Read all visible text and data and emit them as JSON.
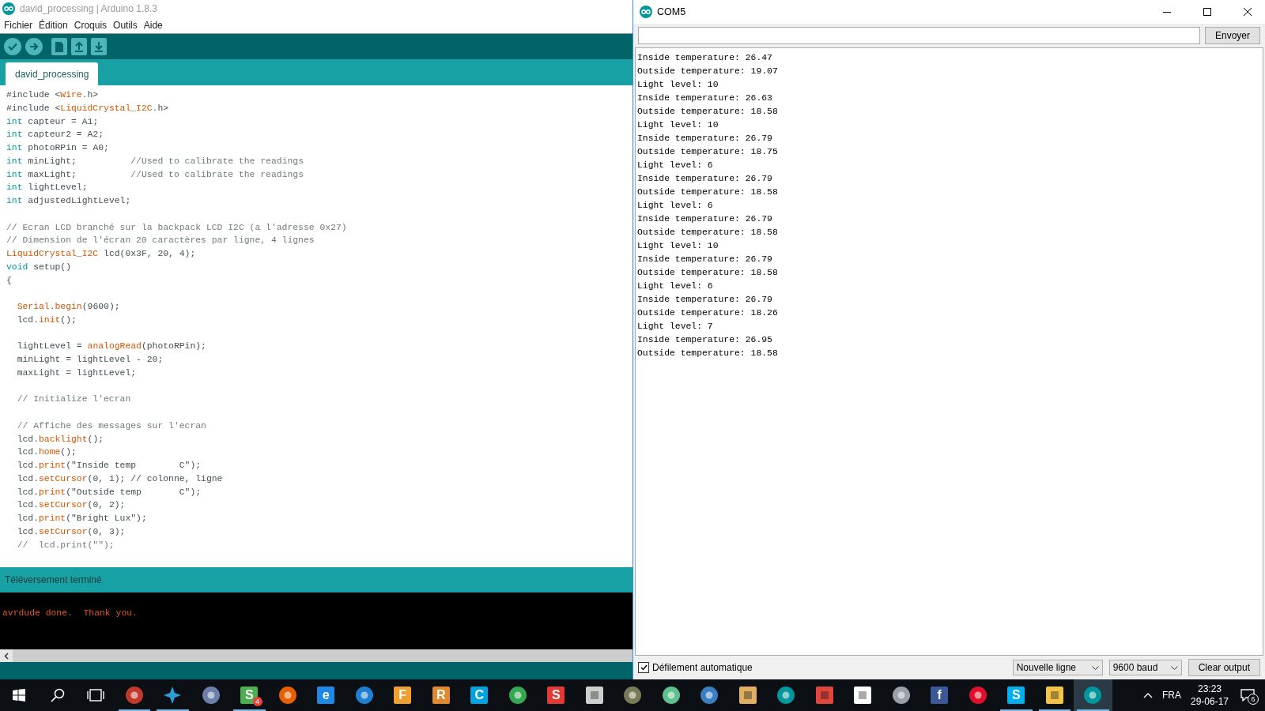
{
  "ide_window": {
    "title": "david_processing | Arduino 1.8.3",
    "menu": [
      "Fichier",
      "Édition",
      "Croquis",
      "Outils",
      "Aide"
    ],
    "toolbar": [
      {
        "kind": "verify"
      },
      {
        "kind": "upload"
      },
      {
        "kind": "new"
      },
      {
        "kind": "open"
      },
      {
        "kind": "save"
      }
    ],
    "tabs": [
      {
        "label": "david_processing",
        "selected": true
      }
    ],
    "code_lines": [
      [
        {
          "text": "#include <",
          "kind": "plain"
        },
        {
          "text": "Wire",
          "kind": "fn"
        },
        {
          "text": ".h>",
          "kind": "plain"
        }
      ],
      [
        {
          "text": "#include <",
          "kind": "plain"
        },
        {
          "text": "LiquidCrystal_I2C",
          "kind": "fn"
        },
        {
          "text": ".h>",
          "kind": "plain"
        }
      ],
      [
        {
          "text": "int",
          "kind": "kw"
        },
        {
          "text": " capteur = A1;",
          "kind": "plain"
        }
      ],
      [
        {
          "text": "int",
          "kind": "kw"
        },
        {
          "text": " capteur2 = A2;",
          "kind": "plain"
        }
      ],
      [
        {
          "text": "int",
          "kind": "kw"
        },
        {
          "text": " photoRPin = A0;",
          "kind": "plain"
        }
      ],
      [
        {
          "text": "int",
          "kind": "kw"
        },
        {
          "text": " minLight;          ",
          "kind": "plain"
        },
        {
          "text": "//Used to calibrate the readings",
          "kind": "comment"
        }
      ],
      [
        {
          "text": "int",
          "kind": "kw"
        },
        {
          "text": " maxLight;          ",
          "kind": "plain"
        },
        {
          "text": "//Used to calibrate the readings",
          "kind": "comment"
        }
      ],
      [
        {
          "text": "int",
          "kind": "kw"
        },
        {
          "text": " lightLevel;",
          "kind": "plain"
        }
      ],
      [
        {
          "text": "int",
          "kind": "kw"
        },
        {
          "text": " adjustedLightLevel;",
          "kind": "plain"
        }
      ],
      {
        "kind": "blank"
      },
      [
        {
          "text": "// Ecran LCD branché sur la backpack LCD I2C (a l'adresse 0x27)",
          "kind": "comment"
        }
      ],
      [
        {
          "text": "// Dimension de l'écran 20 caractères par ligne, 4 lignes",
          "kind": "comment"
        }
      ],
      [
        {
          "text": "LiquidCrystal_I2C",
          "kind": "fn"
        },
        {
          "text": " lcd(0x3F, 20, 4);",
          "kind": "plain"
        }
      ],
      [
        {
          "text": "void",
          "kind": "kw"
        },
        {
          "text": " setup()",
          "kind": "plain"
        }
      ],
      [
        {
          "text": "{",
          "kind": "plain"
        }
      ],
      {
        "kind": "blank"
      },
      [
        {
          "text": "  Serial",
          "kind": "fn"
        },
        {
          "text": ".",
          "kind": "plain"
        },
        {
          "text": "begin",
          "kind": "fn"
        },
        {
          "text": "(9600);",
          "kind": "plain"
        }
      ],
      [
        {
          "text": "  lcd.",
          "kind": "plain"
        },
        {
          "text": "init",
          "kind": "fn"
        },
        {
          "text": "();",
          "kind": "plain"
        }
      ],
      {
        "kind": "blank"
      },
      [
        {
          "text": "  lightLevel = ",
          "kind": "plain"
        },
        {
          "text": "analogRead",
          "kind": "fn"
        },
        {
          "text": "(photoRPin);",
          "kind": "plain"
        }
      ],
      [
        {
          "text": "  minLight = lightLevel - 20;",
          "kind": "plain"
        }
      ],
      [
        {
          "text": "  maxLight = lightLevel;",
          "kind": "plain"
        }
      ],
      {
        "kind": "blank"
      },
      [
        {
          "text": "  // Initialize l'ecran",
          "kind": "comment"
        }
      ],
      {
        "kind": "blank"
      },
      [
        {
          "text": "  // Affiche des messages sur l'ecran",
          "kind": "comment"
        }
      ],
      [
        {
          "text": "  lcd.",
          "kind": "plain"
        },
        {
          "text": "backlight",
          "kind": "fn"
        },
        {
          "text": "();",
          "kind": "plain"
        }
      ],
      [
        {
          "text": "  lcd.",
          "kind": "plain"
        },
        {
          "text": "home",
          "kind": "fn"
        },
        {
          "text": "();",
          "kind": "plain"
        }
      ],
      [
        {
          "text": "  lcd.",
          "kind": "plain"
        },
        {
          "text": "print",
          "kind": "fn"
        },
        {
          "text": "(\"Inside temp        C\");",
          "kind": "plain"
        }
      ],
      [
        {
          "text": "  lcd.",
          "kind": "plain"
        },
        {
          "text": "setCursor",
          "kind": "fn"
        },
        {
          "text": "(0, 1); // colonne, ligne",
          "kind": "plain"
        }
      ],
      [
        {
          "text": "  lcd.",
          "kind": "plain"
        },
        {
          "text": "print",
          "kind": "fn"
        },
        {
          "text": "(\"Outside temp       C\");",
          "kind": "plain"
        }
      ],
      [
        {
          "text": "  lcd.",
          "kind": "plain"
        },
        {
          "text": "setCursor",
          "kind": "fn"
        },
        {
          "text": "(0, 2);",
          "kind": "plain"
        }
      ],
      [
        {
          "text": "  lcd.",
          "kind": "plain"
        },
        {
          "text": "print",
          "kind": "fn"
        },
        {
          "text": "(\"Bright Lux\");",
          "kind": "plain"
        }
      ],
      [
        {
          "text": "  lcd.",
          "kind": "plain"
        },
        {
          "text": "setCursor",
          "kind": "fn"
        },
        {
          "text": "(0, 3);",
          "kind": "plain"
        }
      ],
      [
        {
          "text": "  //  lcd.print(\"\");",
          "kind": "comment"
        }
      ]
    ],
    "status": "Téléversement terminé",
    "console_lines": [
      "avrdude done.  Thank you."
    ]
  },
  "serial_monitor": {
    "title": "COM5",
    "send_button": "Envoyer",
    "output": [
      "Inside temperature: 26.47",
      "Outside temperature: 19.07",
      "Light level: 10",
      "Inside temperature: 26.63",
      "Outside temperature: 18.58",
      "Light level: 10",
      "Inside temperature: 26.79",
      "Outside temperature: 18.75",
      "Light level: 6",
      "Inside temperature: 26.79",
      "Outside temperature: 18.58",
      "Light level: 6",
      "Inside temperature: 26.79",
      "Outside temperature: 18.58",
      "Light level: 10",
      "Inside temperature: 26.79",
      "Outside temperature: 18.58",
      "Light level: 6",
      "Inside temperature: 26.79",
      "Outside temperature: 18.26",
      "Light level: 7",
      "Inside temperature: 26.95",
      "Outside temperature: 18.58"
    ],
    "autoscroll": {
      "label": "Défilement automatique",
      "checked": true
    },
    "line_ending": "Nouvelle ligne",
    "baud": "9600 baud",
    "clear_button": "Clear output"
  },
  "taskbar": {
    "apps": [
      {
        "kind": "start",
        "running": false
      },
      {
        "kind": "search",
        "running": false
      },
      {
        "kind": "taskview",
        "running": false
      },
      {
        "kind": "disc",
        "color": "#c0392b",
        "running": true
      },
      {
        "kind": "star",
        "color": "#2a9fd6",
        "running": true
      },
      {
        "kind": "disc",
        "color": "#6b7fa8",
        "running": false
      },
      {
        "kind": "letter",
        "letter": "S",
        "color": "#4caf50",
        "badge": "4",
        "running": true
      },
      {
        "kind": "disc",
        "color": "#e66000",
        "running": false
      },
      {
        "kind": "letter",
        "letter": "e",
        "color": "#1e88e5",
        "running": false
      },
      {
        "kind": "disc",
        "color": "#1f7fd0",
        "running": false
      },
      {
        "kind": "letter",
        "letter": "F",
        "color": "#f0a030",
        "running": false
      },
      {
        "kind": "letter",
        "letter": "R",
        "color": "#e08a2c",
        "running": false
      },
      {
        "kind": "letter",
        "letter": "C",
        "color": "#00a3e0",
        "running": false
      },
      {
        "kind": "disc",
        "color": "#34a853",
        "running": false
      },
      {
        "kind": "letter",
        "letter": "S",
        "color": "#e53935",
        "running": false
      },
      {
        "kind": "tile",
        "color": "#cfcfcf",
        "running": false
      },
      {
        "kind": "disc",
        "color": "#7a7a5a",
        "running": false
      },
      {
        "kind": "disc",
        "color": "#5fbf8f",
        "running": false
      },
      {
        "kind": "disc",
        "color": "#3a7fc0",
        "running": false
      },
      {
        "kind": "tile",
        "color": "#e0b060",
        "running": false
      },
      {
        "kind": "disc",
        "color": "#00979c",
        "running": false
      },
      {
        "kind": "tile",
        "color": "#e0463c",
        "running": false
      },
      {
        "kind": "tile",
        "color": "#ffffff",
        "running": false
      },
      {
        "kind": "disc",
        "color": "#9aa0a8",
        "running": false
      },
      {
        "kind": "letter",
        "letter": "f",
        "color": "#3b5998",
        "running": false
      },
      {
        "kind": "disc",
        "color": "#e0102a",
        "running": false
      },
      {
        "kind": "letter",
        "letter": "S",
        "color": "#00aff0",
        "running": true
      },
      {
        "kind": "tile",
        "color": "#f3c445",
        "running": true
      },
      {
        "kind": "disc",
        "color": "#00979c",
        "running": true,
        "active": true
      }
    ],
    "language": "FRA",
    "time": "23:23",
    "date": "29-06-17",
    "notifications": "6"
  }
}
